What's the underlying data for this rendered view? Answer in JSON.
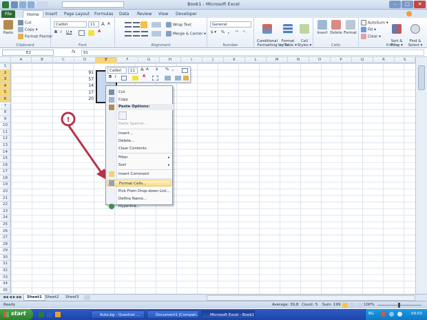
{
  "window": {
    "title": "Book1 - Microsoft Excel",
    "minimize": "–",
    "maximize": "□",
    "close": "✕"
  },
  "tabs": [
    "File",
    "Home",
    "Insert",
    "Page Layout",
    "Formulas",
    "Data",
    "Review",
    "View",
    "Developer"
  ],
  "ribbon": {
    "clipboard": {
      "label": "Clipboard",
      "paste": "Paste",
      "cut": "Cut",
      "copy": "Copy ▾",
      "format_painter": "Format Painter"
    },
    "font": {
      "label": "Font",
      "name": "Calibri",
      "size": "11",
      "grow": "A",
      "shrink": "A",
      "bold": "B",
      "italic": "I",
      "underline": "U ▾",
      "font_color": "A"
    },
    "alignment": {
      "label": "Alignment",
      "wrap": "Wrap Text",
      "merge": "Merge & Center ▾"
    },
    "number": {
      "label": "Number",
      "format": "General",
      "currency": "$ ▾",
      "percent": "%",
      "comma": ",",
      "dec_inc": "⁺⁰",
      "dec_dec": "⁰₋"
    },
    "styles": {
      "label": "Styles",
      "conditional": "Conditional\nFormatting ▾",
      "format_table": "Format\nas Table ▾",
      "cell_styles": "Cell\nStyles ▾"
    },
    "cells": {
      "label": "Cells",
      "insert": "Insert",
      "delete": "Delete",
      "format": "Format"
    },
    "editing": {
      "label": "Editing",
      "autosum": "AutoSum ▾",
      "fill": "Fill ▾",
      "clear": "Clear ▾",
      "sort": "Sort &\nFilter ▾",
      "find": "Find &\nSelect ▾"
    }
  },
  "formula_bar": {
    "name_box": "E2",
    "fx": "fx",
    "value": "91"
  },
  "columns": [
    "A",
    "B",
    "C",
    "D",
    "E",
    "F",
    "G",
    "H",
    "I",
    "J",
    "K",
    "L",
    "M",
    "N",
    "O",
    "P",
    "Q",
    "R",
    "S"
  ],
  "rows": [
    "1",
    "2",
    "3",
    "4",
    "5",
    "6",
    "7",
    "8",
    "9",
    "10",
    "11",
    "12",
    "13",
    "14",
    "15",
    "16",
    "17",
    "18",
    "19",
    "20",
    "21",
    "22",
    "23",
    "24",
    "25",
    "26",
    "27",
    "28",
    "29",
    "30",
    "31",
    "32",
    "33",
    "34",
    "35"
  ],
  "cells": [
    {
      "ref": "D2",
      "value": "91"
    },
    {
      "ref": "D3",
      "value": "57"
    },
    {
      "ref": "D4",
      "value": "14"
    },
    {
      "ref": "D5",
      "value": "17"
    },
    {
      "ref": "D6",
      "value": "20"
    }
  ],
  "mini_toolbar": {
    "font": "Calibri",
    "size": "11",
    "grow": "A",
    "shrink": "A",
    "currency": "$",
    "percent": "%",
    "comma": ",",
    "bold": "B",
    "italic": "I",
    "font_color": "A"
  },
  "context_menu": {
    "items": [
      {
        "label": "Cut",
        "type": "item"
      },
      {
        "label": "Copy",
        "type": "item"
      },
      {
        "label": "Paste Options:",
        "type": "header"
      },
      {
        "label": "Paste Special...",
        "type": "disabled"
      },
      {
        "label": "Insert...",
        "type": "item"
      },
      {
        "label": "Delete...",
        "type": "item"
      },
      {
        "label": "Clear Contents",
        "type": "item"
      },
      {
        "label": "Filter",
        "type": "submenu"
      },
      {
        "label": "Sort",
        "type": "submenu"
      },
      {
        "label": "Insert Comment",
        "type": "item"
      },
      {
        "label": "Format Cells...",
        "type": "highlight"
      },
      {
        "label": "Pick From Drop-down List...",
        "type": "item"
      },
      {
        "label": "Define Name...",
        "type": "item"
      },
      {
        "label": "Hyperlink...",
        "type": "item"
      }
    ]
  },
  "annotation": {
    "marker": "!"
  },
  "sheet_tabs": [
    "Sheet1",
    "Sheet2",
    "Sheet3"
  ],
  "status": {
    "ready": "Ready",
    "average": "Average: 39,8",
    "count": "Count: 5",
    "sum": "Sum: 199",
    "zoom": "100%"
  },
  "taskbar": {
    "start": "start",
    "items": [
      "Auto.bg - Question ...",
      "Document1 [Compati...",
      "Microsoft Excel - Book1"
    ],
    "lang": "BG",
    "clock": "09:03"
  },
  "colors": {
    "accent_green": "#2a6a33",
    "selection": "#c6d9f1",
    "arrow": "#b5334a",
    "highlight": "#fbdc88"
  }
}
